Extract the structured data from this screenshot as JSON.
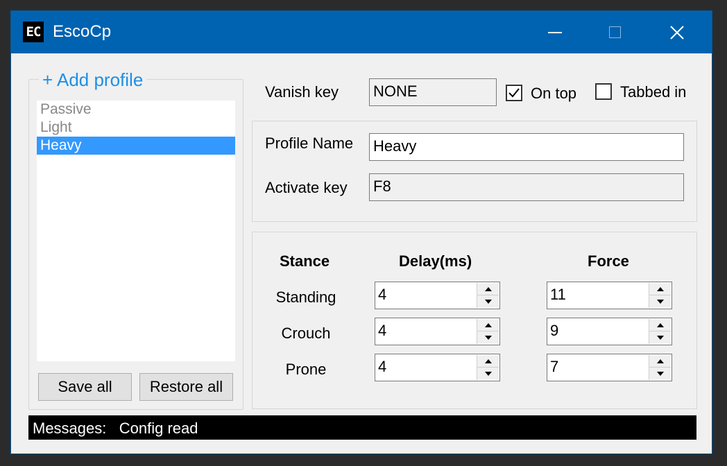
{
  "window": {
    "title": "EscoCp",
    "app_icon_text": "EC",
    "icons": [
      "minimize-icon",
      "maximize-icon",
      "close-icon"
    ]
  },
  "profiles": {
    "add_label": "+ Add profile",
    "items": [
      {
        "name": "Passive",
        "selected": false
      },
      {
        "name": "Light",
        "selected": false
      },
      {
        "name": "Heavy",
        "selected": true
      }
    ],
    "save_all": "Save all",
    "restore_all": "Restore all"
  },
  "settings": {
    "vanish_key_label": "Vanish key",
    "vanish_key_value": "NONE",
    "on_top_label": "On top",
    "on_top_checked": true,
    "tabbed_in_label": "Tabbed in",
    "tabbed_in_checked": false,
    "profile_name_label": "Profile Name",
    "profile_name_value": "Heavy",
    "activate_key_label": "Activate key",
    "activate_key_value": "F8"
  },
  "stances": {
    "headers": {
      "stance": "Stance",
      "delay": "Delay(ms)",
      "force": "Force"
    },
    "rows": [
      {
        "stance": "Standing",
        "delay": "4",
        "force": "11"
      },
      {
        "stance": "Crouch",
        "delay": "4",
        "force": "9"
      },
      {
        "stance": "Prone",
        "delay": "4",
        "force": "7"
      }
    ]
  },
  "status": {
    "label": "Messages:",
    "message": "Config read"
  },
  "colors": {
    "titlebar": "#0063b1",
    "accent": "#1e8fe6",
    "selection": "#3399ff"
  }
}
